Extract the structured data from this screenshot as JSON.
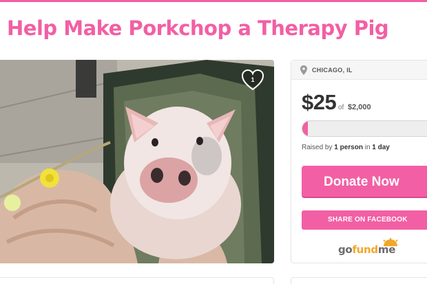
{
  "campaign": {
    "title": "Help Make Porkchop a Therapy Pig",
    "likes": "1"
  },
  "sidebar": {
    "location": "CHICAGO, IL",
    "raised": "$25",
    "goal_prefix": "of",
    "goal": "$2,000",
    "progress_fraction": 0.0125,
    "raised_by_prefix": "Raised by",
    "raised_by_count": "1 person",
    "raised_by_mid": "in",
    "raised_by_duration": "1 day",
    "donate_label": "Donate Now",
    "share_label": "SHARE ON FACEBOOK"
  },
  "logo": {
    "part1": "go",
    "part2": "fund",
    "part3": "me"
  },
  "colors": {
    "brand_pink": "#f25fa4",
    "logo_orange": "#f2a72b"
  },
  "icons": [
    "heart-icon",
    "location-pin-icon",
    "gofundme-sun-icon"
  ]
}
